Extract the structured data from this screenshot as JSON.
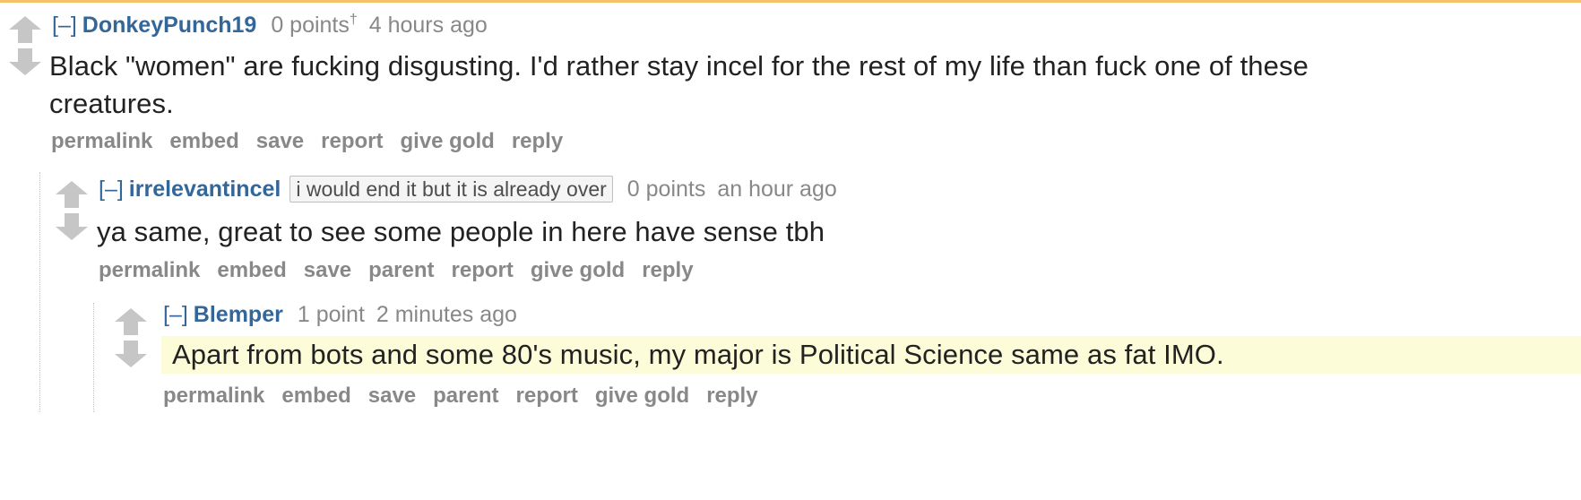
{
  "comments": [
    {
      "toggle": "[–]",
      "author": "DonkeyPunch19",
      "score": "0 points",
      "score_mark": "†",
      "time": "4 hours ago",
      "body_line1": "Black \"women\" are fucking disgusting. I'd rather stay incel for the rest of my life than fuck one of these",
      "body_line2": "creatures.",
      "buttons": [
        "permalink",
        "embed",
        "save",
        "report",
        "give gold",
        "reply"
      ]
    },
    {
      "toggle": "[–]",
      "author": "irrelevantincel",
      "flair": "i would end it but it is already over",
      "score": "0 points",
      "time": "an hour ago",
      "body": "ya same, great to see some people in here have sense tbh",
      "buttons": [
        "permalink",
        "embed",
        "save",
        "parent",
        "report",
        "give gold",
        "reply"
      ]
    },
    {
      "toggle": "[–]",
      "author": "Blemper",
      "score": "1 point",
      "time": "2 minutes ago",
      "body": "Apart from bots and some 80's music, my major is Political Science same as fat IMO.",
      "buttons": [
        "permalink",
        "embed",
        "save",
        "parent",
        "report",
        "give gold",
        "reply"
      ]
    }
  ],
  "colors": {
    "link": "#336699",
    "meta": "#888888",
    "highlight": "#fcfcd9",
    "top_rule": "#f5c26b"
  },
  "icons": {
    "upvote": "upvote-arrow-icon",
    "downvote": "downvote-arrow-icon"
  }
}
